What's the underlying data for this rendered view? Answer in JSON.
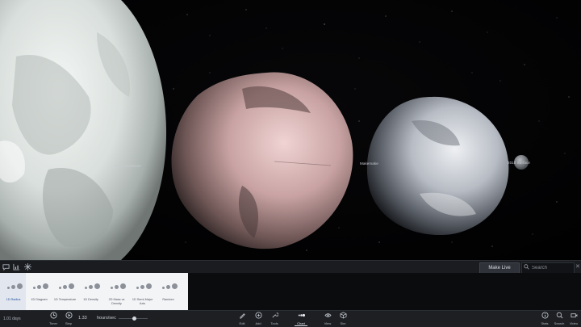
{
  "viewport": {
    "labels": {
      "dwarf_left": "2003 SubMoon",
      "dwarf_middle": "Makemake",
      "dwarf_right": "2010 Surface",
      "moon": "MK2"
    }
  },
  "panel": {
    "make_live_label": "Make Live",
    "search_placeholder": "Search",
    "tool_icons": [
      "chat-icon",
      "chart-icon",
      "sparkle-icon"
    ]
  },
  "chart_types": [
    {
      "label": "1D Radius",
      "selected": true
    },
    {
      "label": "1D Diagram",
      "selected": false
    },
    {
      "label": "1D Temperature",
      "selected": false
    },
    {
      "label": "1D Density",
      "selected": false
    },
    {
      "label": "2D Mass vs Density",
      "selected": false
    },
    {
      "label": "1D Semi-Major Axis",
      "selected": false
    },
    {
      "label": "Random",
      "selected": false
    }
  ],
  "toolbar": {
    "time_readout": "1.01 days",
    "timer_label": "Timer",
    "step_label": "Step",
    "rate_value": "1.33",
    "rate_unit": "hours/sec",
    "rate_level": 0.55,
    "items": [
      {
        "label": "Edit",
        "icon": "pencil-icon"
      },
      {
        "label": "Add",
        "icon": "plus-icon"
      },
      {
        "label": "Tools",
        "icon": "wrench-icon"
      },
      {
        "label": "Chart",
        "icon": "chart-dots-icon",
        "active": true
      },
      {
        "label": "View",
        "icon": "eye-icon"
      },
      {
        "label": "Sim",
        "icon": "cube-icon"
      }
    ],
    "right_items": [
      {
        "label": "Stats",
        "icon": "info-icon"
      },
      {
        "label": "Search",
        "icon": "search-icon"
      },
      {
        "label": "Video",
        "icon": "video-icon"
      }
    ]
  }
}
